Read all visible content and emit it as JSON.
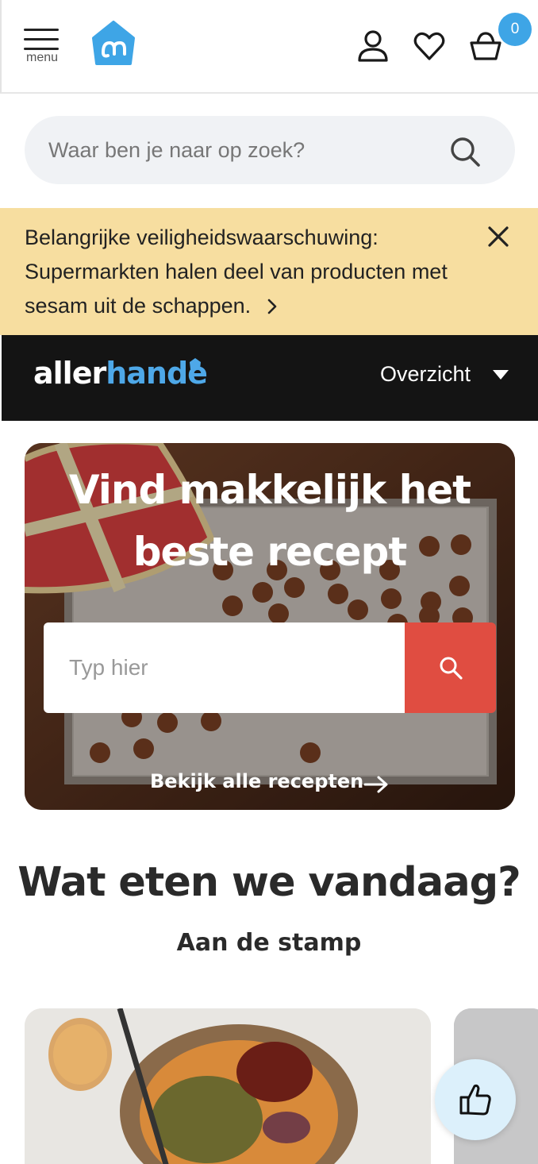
{
  "header": {
    "menu_label": "menu",
    "logo_icon": "albert-heijn-logo",
    "cart_count": "0",
    "icons": [
      "user-icon",
      "heart-icon",
      "basket-icon"
    ]
  },
  "search": {
    "placeholder": "Waar ben je naar op zoek?"
  },
  "alert": {
    "text": "Belangrijke veiligheidswaarschuwing: Supermarkten halen deel van producten met sesam uit de schappen."
  },
  "allerhande": {
    "logo_part1": "aller",
    "logo_part2": "hande",
    "overview_label": "Overzicht"
  },
  "hero": {
    "title_line1": "Vind makkelijk het",
    "title_line2": "beste recept",
    "input_placeholder": "Typ hier",
    "link_label": "Bekijk alle recepten"
  },
  "section": {
    "title": "Wat eten we vandaag?",
    "subtitle": "Aan de stamp"
  },
  "colors": {
    "brand_blue": "#3ea5e6",
    "alert_bg": "#f7dea0",
    "allerhande_bar": "#141414",
    "hero_button": "#e04d41"
  }
}
